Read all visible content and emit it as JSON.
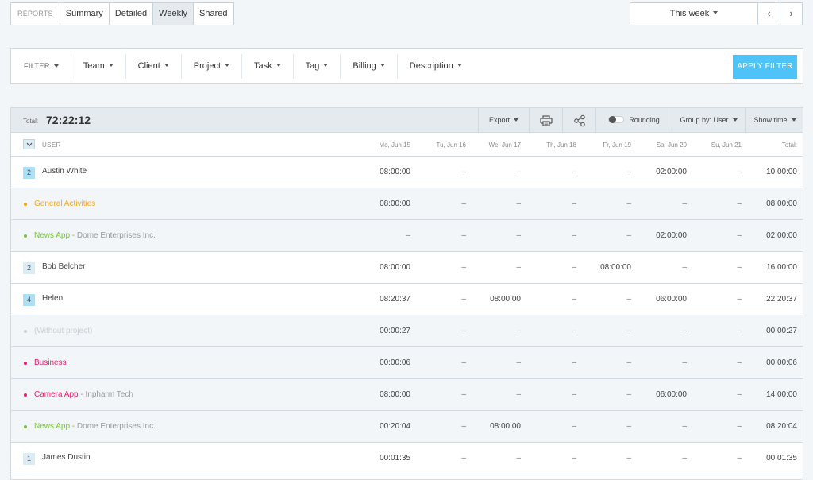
{
  "tabs": {
    "reports": "REPORTS",
    "summary": "Summary",
    "detailed": "Detailed",
    "weekly": "Weekly",
    "shared": "Shared"
  },
  "date_range": {
    "label": "This week",
    "prev": "‹",
    "next": "›"
  },
  "filter_bar": {
    "filter_label": "FILTER",
    "items": [
      "Team",
      "Client",
      "Project",
      "Task",
      "Tag",
      "Billing",
      "Description"
    ],
    "apply_label": "APPLY FILTER"
  },
  "report": {
    "total_label": "Total:",
    "total_value": "72:22:12",
    "export_label": "Export",
    "rounding_label": "Rounding",
    "group_by_label": "Group by: User",
    "show_time_label": "Show time",
    "columns": {
      "user": "USER",
      "days": [
        "Mo, Jun 15",
        "Tu, Jun 16",
        "We, Jun 17",
        "Th, Jun 18",
        "Fr, Jun 19",
        "Sa, Jun 20",
        "Su, Jun 21"
      ],
      "total": "Total:"
    },
    "rows": [
      {
        "type": "user",
        "badge": "2",
        "badge_dark": true,
        "name": "Austin White",
        "cells": [
          "08:00:00",
          "–",
          "–",
          "–",
          "–",
          "02:00:00",
          "–"
        ],
        "total": "10:00:00"
      },
      {
        "type": "project",
        "color": "#f5a623",
        "name": "General Activities",
        "client": "",
        "cells": [
          "08:00:00",
          "–",
          "–",
          "–",
          "–",
          "–",
          "–"
        ],
        "total": "08:00:00"
      },
      {
        "type": "project",
        "color": "#7cc045",
        "name": "News App",
        "client": " - Dome Enterprises Inc.",
        "cells": [
          "–",
          "–",
          "–",
          "–",
          "–",
          "02:00:00",
          "–"
        ],
        "total": "02:00:00"
      },
      {
        "type": "user",
        "badge": "2",
        "badge_dark": false,
        "name": "Bob Belcher",
        "cells": [
          "08:00:00",
          "–",
          "–",
          "–",
          "08:00:00",
          "–",
          "–"
        ],
        "total": "16:00:00"
      },
      {
        "type": "user",
        "badge": "4",
        "badge_dark": true,
        "name": "Helen",
        "cells": [
          "08:20:37",
          "–",
          "08:00:00",
          "–",
          "–",
          "06:00:00",
          "–"
        ],
        "total": "22:20:37"
      },
      {
        "type": "project",
        "color": "#c8cfd4",
        "name": "(Without project)",
        "client": "",
        "cells": [
          "00:00:27",
          "–",
          "–",
          "–",
          "–",
          "–",
          "–"
        ],
        "total": "00:00:27"
      },
      {
        "type": "project",
        "color": "#e91e63",
        "name": "Business",
        "client": "",
        "cells": [
          "00:00:06",
          "–",
          "–",
          "–",
          "–",
          "–",
          "–"
        ],
        "total": "00:00:06"
      },
      {
        "type": "project",
        "color": "#e91e63",
        "name": "Camera App",
        "client": " - Inpharm Tech",
        "cells": [
          "08:00:00",
          "–",
          "–",
          "–",
          "–",
          "06:00:00",
          "–"
        ],
        "total": "14:00:00"
      },
      {
        "type": "project",
        "color": "#7cc045",
        "name": "News App",
        "client": " - Dome Enterprises Inc.",
        "cells": [
          "00:20:04",
          "–",
          "08:00:00",
          "–",
          "–",
          "–",
          "–"
        ],
        "total": "08:20:04"
      },
      {
        "type": "user",
        "badge": "1",
        "badge_dark": false,
        "name": "James Dustin",
        "cells": [
          "00:01:35",
          "–",
          "–",
          "–",
          "–",
          "–",
          "–"
        ],
        "total": "00:01:35"
      }
    ]
  }
}
